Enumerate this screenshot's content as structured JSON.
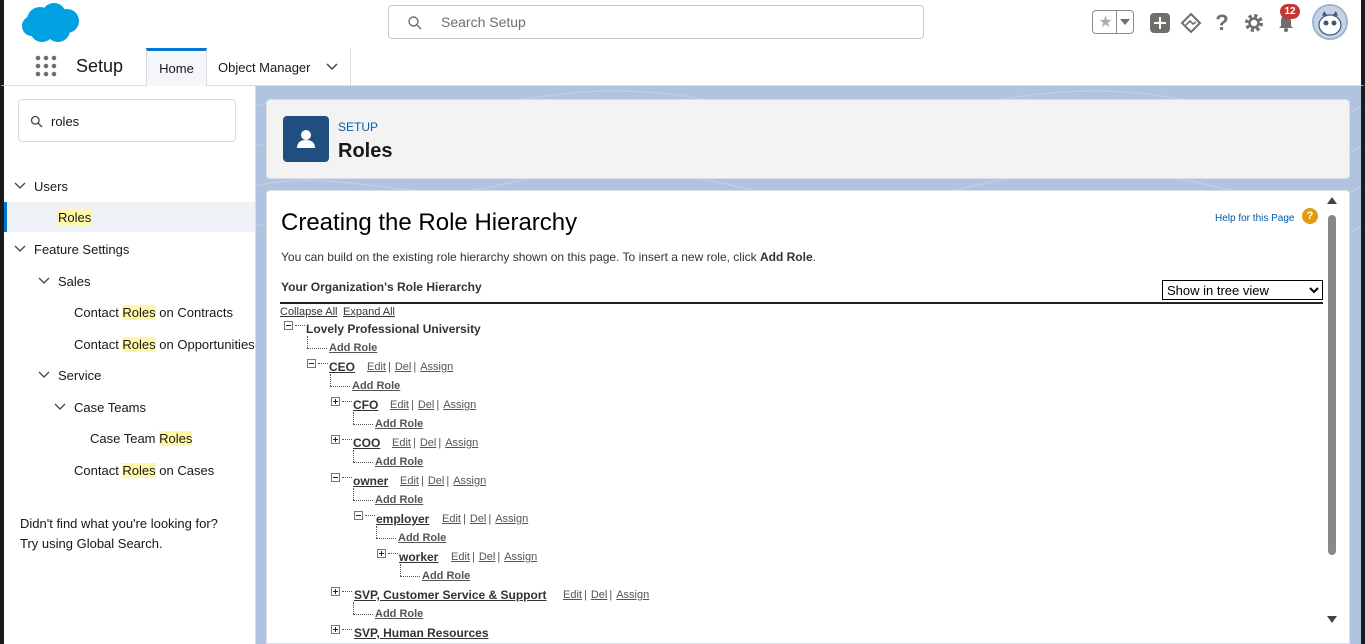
{
  "header": {
    "search_placeholder": "Search Setup",
    "notification_count": "12"
  },
  "nav": {
    "app_name": "Setup",
    "tabs": [
      {
        "label": "Home"
      },
      {
        "label": "Object Manager"
      }
    ]
  },
  "sidebar": {
    "quick_find_value": "roles",
    "tree": {
      "users": "Users",
      "roles": "Roles",
      "feature_settings": "Feature Settings",
      "sales": "Sales",
      "contact_roles_contracts_pre": "Contact ",
      "contact_roles_contracts_hl": "Roles",
      "contact_roles_contracts_post": " on Contracts",
      "contact_roles_opps_pre": "Contact ",
      "contact_roles_opps_hl": "Roles",
      "contact_roles_opps_post": " on Opportunities",
      "service": "Service",
      "case_teams": "Case Teams",
      "case_team_roles_pre": "Case Team ",
      "case_team_roles_hl": "Roles",
      "contact_roles_cases_pre": "Contact ",
      "contact_roles_cases_hl": "Roles",
      "contact_roles_cases_post": " on Cases"
    },
    "help_line1": "Didn't find what you're looking for?",
    "help_line2": "Try using Global Search."
  },
  "page_header": {
    "eyebrow": "SETUP",
    "title": "Roles"
  },
  "content": {
    "title": "Creating the Role Hierarchy",
    "help_link": "Help for this Page",
    "intro_pre": "You can build on the existing role hierarchy shown on this page. To insert a new role, click ",
    "intro_bold": "Add Role",
    "intro_post": ".",
    "hierarchy_heading": "Your Organization's Role Hierarchy",
    "view_select": "Show in tree view",
    "collapse_all": "Collapse All",
    "expand_all": "Expand All",
    "root": "Lovely Professional University",
    "add_role": "Add Role",
    "edit": "Edit",
    "del": "Del",
    "assign": "Assign",
    "roles": {
      "ceo": "CEO",
      "cfo": "CFO",
      "coo": "COO",
      "owner": "owner",
      "employer": "employer",
      "worker": "worker",
      "svp_css": "SVP, Customer Service & Support",
      "svp_hr": "SVP, Human Resources"
    }
  },
  "colors": {
    "brand_blue": "#0176d3",
    "background_blue": "#b0c4df",
    "page_icon": "#1f4f7f",
    "badge_red": "#c23934",
    "highlight": "#fff8a6"
  }
}
